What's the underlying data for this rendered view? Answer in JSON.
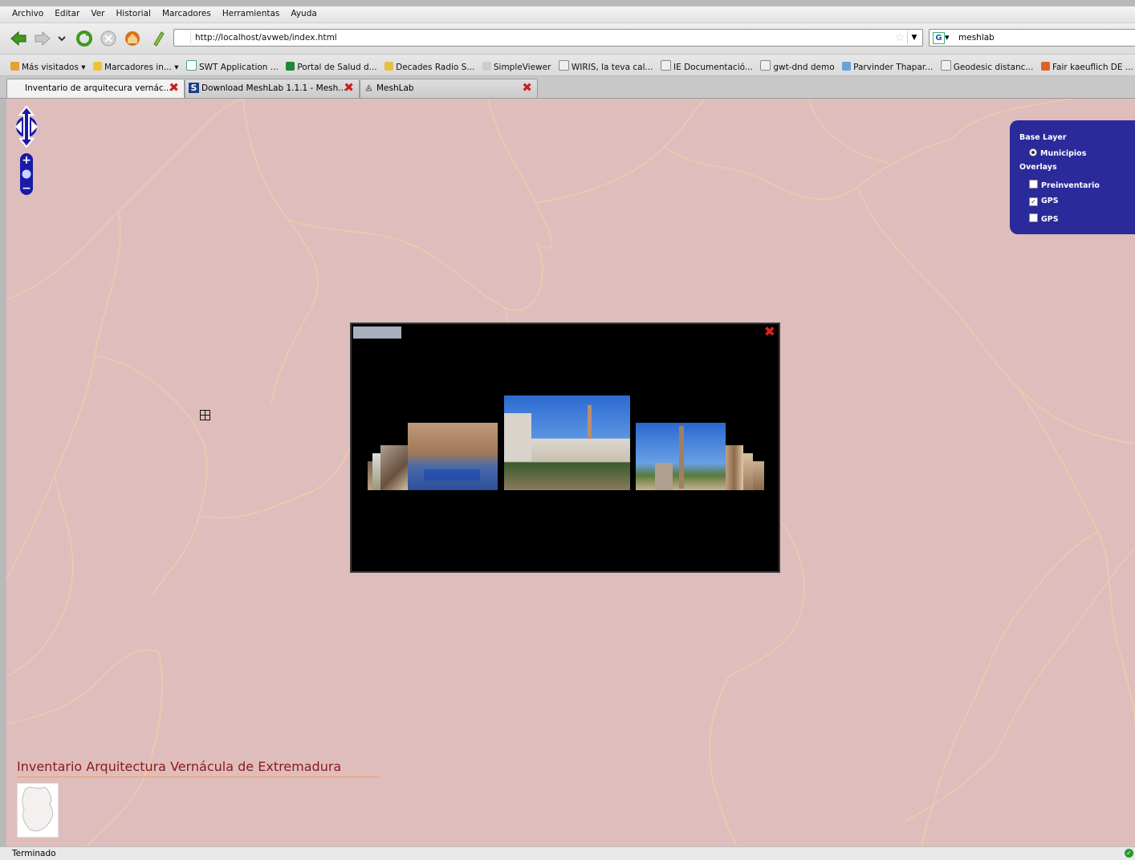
{
  "menubar": {
    "items": [
      "Archivo",
      "Editar",
      "Ver",
      "Historial",
      "Marcadores",
      "Herramientas",
      "Ayuda"
    ]
  },
  "navbar": {
    "url": "http://localhost/avweb/index.html",
    "search_text": "meshlab",
    "search_engine": "G"
  },
  "bookmarks": {
    "items": [
      "Más visitados ▾",
      "Marcadores in... ▾",
      "SWT Application ...",
      "Portal de Salud d...",
      "Decades Radio S...",
      "SimpleViewer",
      "WIRIS, la teva cal...",
      "IE Documentació...",
      "gwt-dnd demo",
      "Parvinder Thapar...",
      "Geodesic distanc...",
      "Fair kaeuflich DE ..."
    ]
  },
  "tabs": [
    {
      "label": "Inventario de arquitecura vernác..."
    },
    {
      "label": "Download MeshLab 1.1.1 - Mesh..."
    },
    {
      "label": "MeshLab"
    }
  ],
  "layer_switcher": {
    "base_title": "Base Layer",
    "base_option": "Municipios",
    "overlays_title": "Overlays",
    "overlay_1": "Preinventario",
    "overlay_2": "GPS",
    "overlay_3": "GPS"
  },
  "site_title": "Inventario Arquitectura Vernácula de Extremadura",
  "status": {
    "text": "Terminado"
  },
  "colors": {
    "map_bg": "#e0bdbd",
    "borders": "#f2d2a0",
    "layer_switcher": "#2a2a9a",
    "title": "#8b1a1a"
  }
}
